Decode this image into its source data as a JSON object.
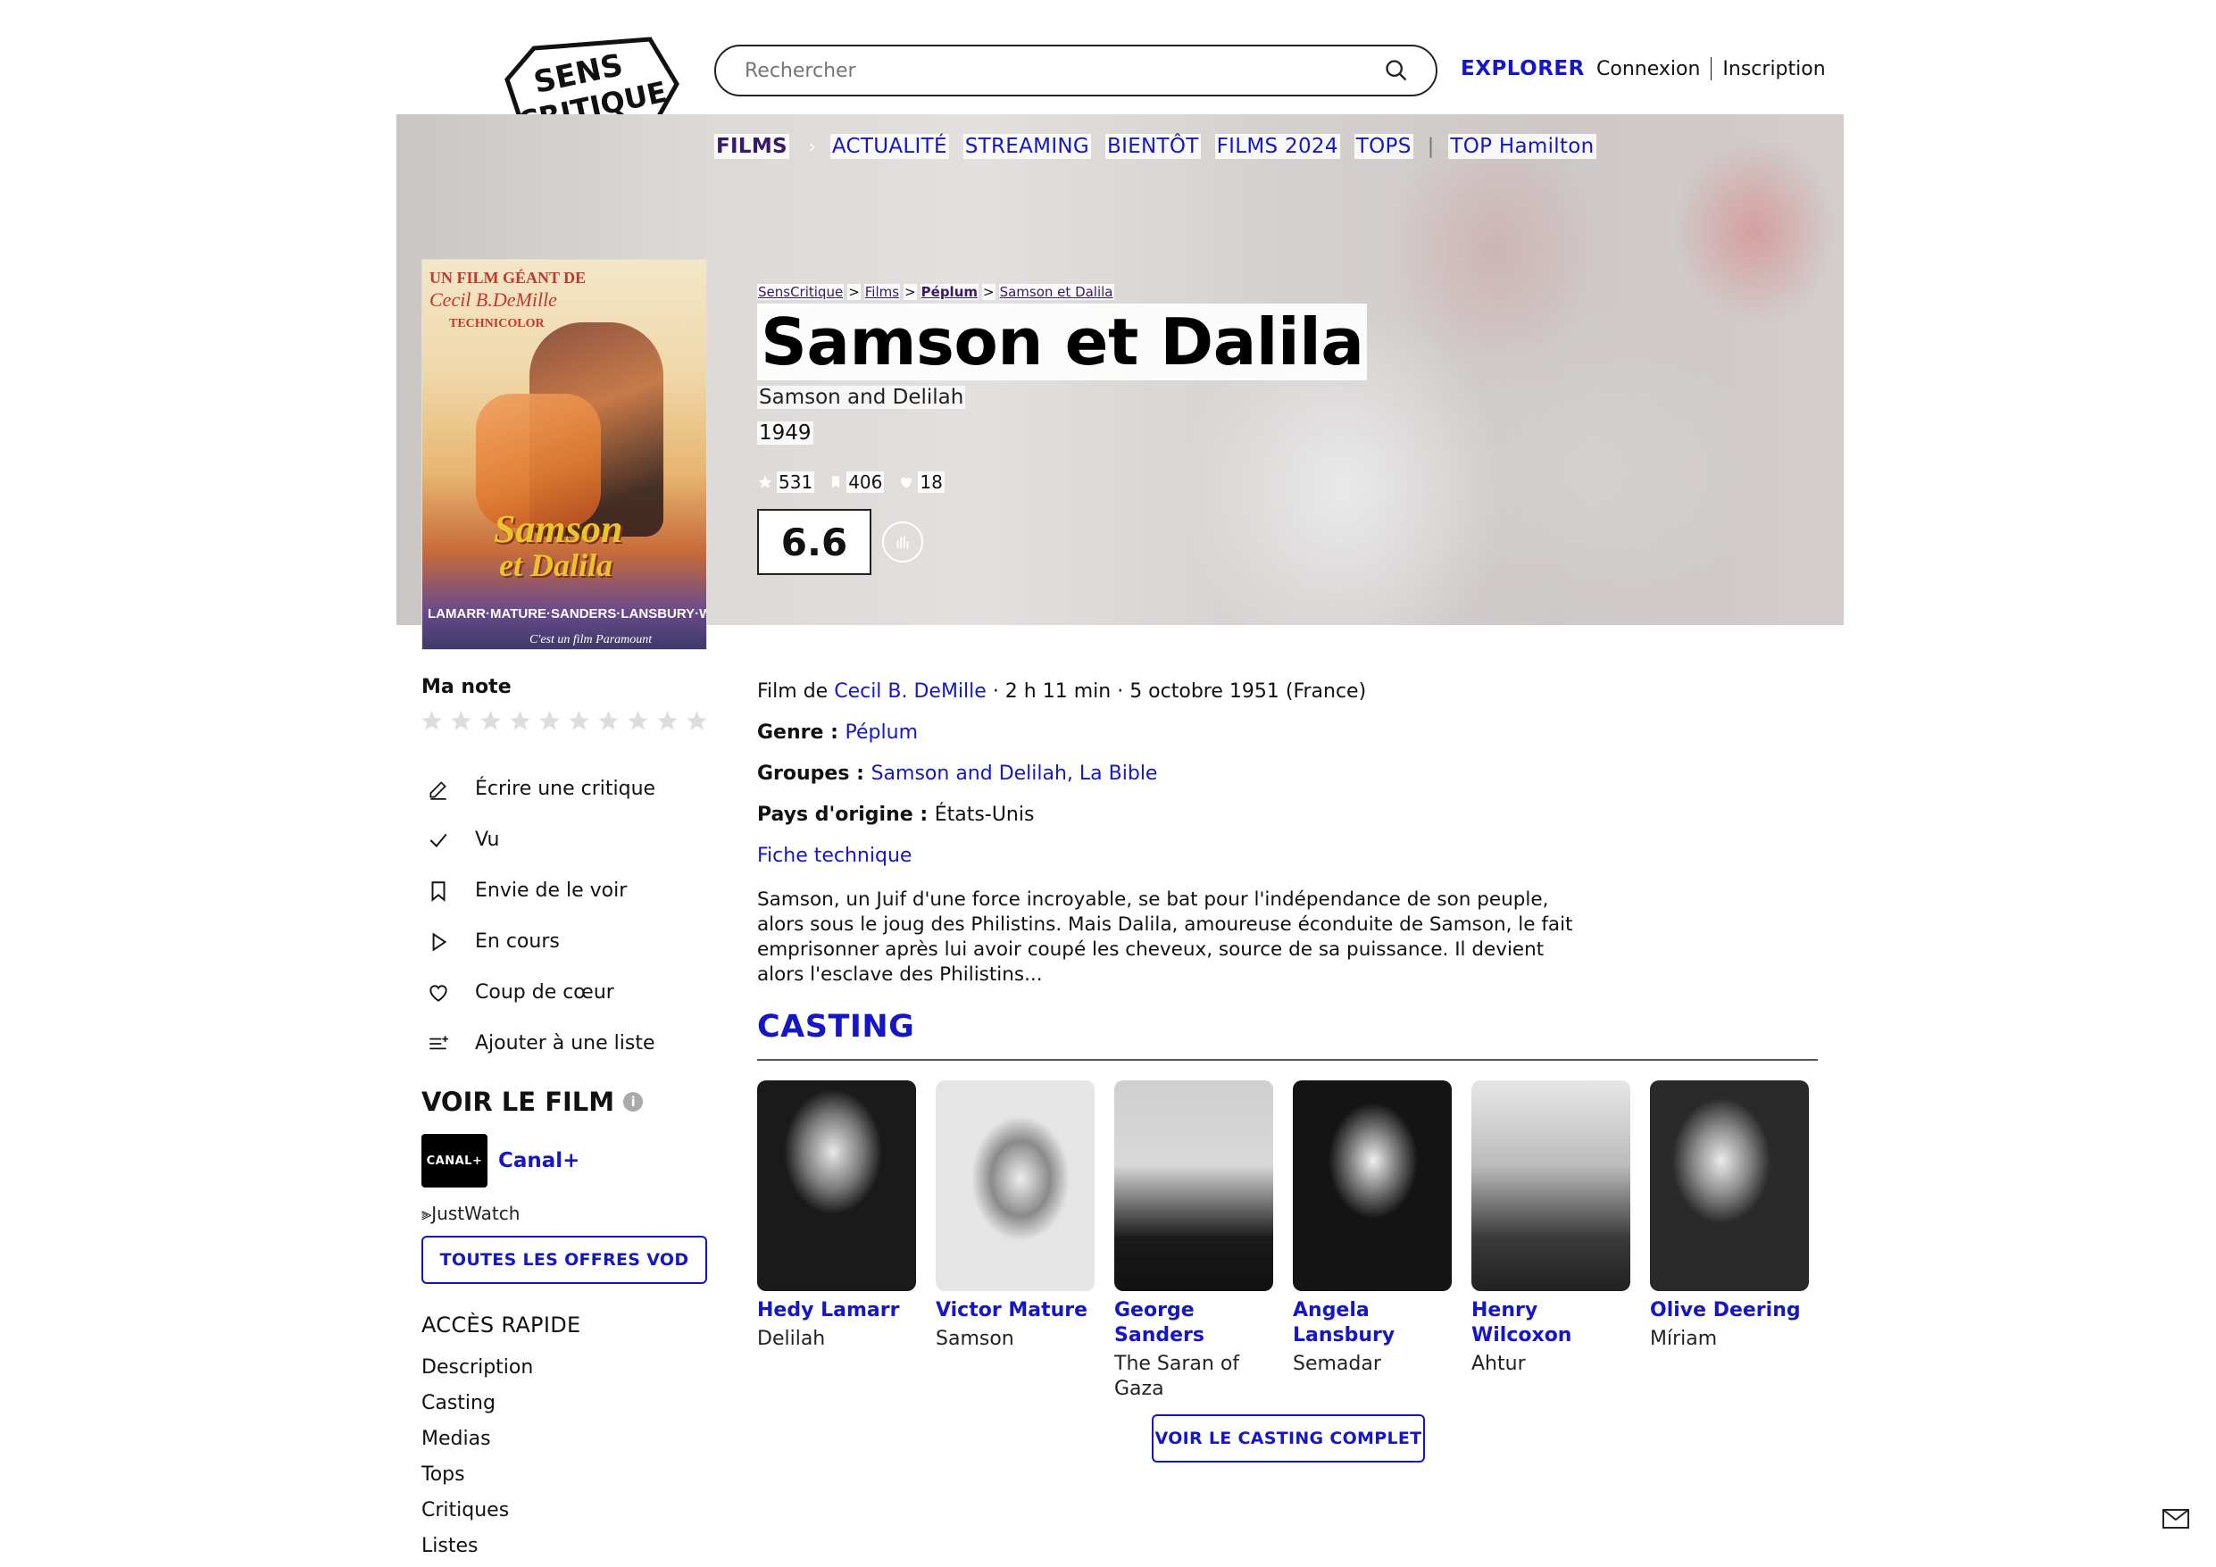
{
  "header": {
    "logo_line1": "SENS",
    "logo_line2": "CRITIQUE",
    "search_placeholder": "Rechercher",
    "explorer": "EXPLORER",
    "login": "Connexion",
    "signup": "Inscription"
  },
  "nav": {
    "films": "FILMS",
    "items": [
      "ACTUALITÉ",
      "STREAMING",
      "BIENTÔT",
      "FILMS 2024",
      "TOPS"
    ],
    "extra": "TOP Hamilton"
  },
  "poster": {
    "line1": "UN FILM GÉANT DE",
    "line2": "Cecil B.DeMille",
    "line3": "TECHNICOLOR",
    "title_a": "Samson",
    "title_b": "et Dalila",
    "cast": "LAMARR·MATURE·SANDERS·LANSBURY·WILCOXON",
    "studio": "C'est un film Paramount"
  },
  "breadcrumbs": [
    "SensCritique",
    "Films",
    "Péplum",
    "Samson et Dalila"
  ],
  "film": {
    "title": "Samson et Dalila",
    "original_title": "Samson and Delilah",
    "year": "1949",
    "stats": {
      "ratings": "531",
      "wishlist": "406",
      "favorites": "18"
    },
    "score": "6.6",
    "credit_prefix": "Film de ",
    "director": "Cecil B. DeMille",
    "credit_suffix": " · 2 h 11 min · 5 octobre 1951 (France)",
    "genre_label": "Genre : ",
    "genre": "Péplum",
    "groups_label": "Groupes : ",
    "groups": "Samson and Delilah, La Bible",
    "country_label": "Pays d'origine : ",
    "country": "États-Unis",
    "tech_sheet": "Fiche technique",
    "synopsis": "Samson, un Juif d'une force incroyable, se bat pour l'indépendance de son peuple, alors sous le joug des Philistins. Mais Dalila, amoureuse éconduite de Samson, le fait emprisonner après lui avoir coupé les cheveux, source de sa puissance. Il devient alors l'esclave des Philistins..."
  },
  "sidebar": {
    "my_rating": "Ma note",
    "actions": [
      {
        "label": "Écrire une critique",
        "icon": "pencil-icon"
      },
      {
        "label": "Vu",
        "icon": "check-icon"
      },
      {
        "label": "Envie de le voir",
        "icon": "bookmark-icon"
      },
      {
        "label": "En cours",
        "icon": "play-icon"
      },
      {
        "label": "Coup de cœur",
        "icon": "heart-icon"
      },
      {
        "label": "Ajouter à une liste",
        "icon": "list-add-icon"
      }
    ],
    "watch_title": "VOIR LE FILM",
    "provider_logo": "CANAL+",
    "provider": "Canal+",
    "justwatch": "JustWatch",
    "vod_button": "TOUTES LES OFFRES VOD",
    "quick_access_title": "ACCÈS RAPIDE",
    "quick_access": [
      "Description",
      "Casting",
      "Medias",
      "Tops",
      "Critiques",
      "Listes"
    ]
  },
  "casting": {
    "title": "CASTING",
    "actors": [
      {
        "name": "Hedy Lamarr",
        "role": "Delilah"
      },
      {
        "name": "Victor Mature",
        "role": "Samson"
      },
      {
        "name": "George Sanders",
        "role": "The Saran of Gaza"
      },
      {
        "name": "Angela Lansbury",
        "role": "Semadar"
      },
      {
        "name": "Henry Wilcoxon",
        "role": "Ahtur"
      },
      {
        "name": "Olive Deering",
        "role": "Míriam"
      }
    ],
    "full_button": "VOIR LE CASTING COMPLET"
  },
  "colors": {
    "accent": "#1517c6",
    "nav_active": "#3a1a66"
  }
}
